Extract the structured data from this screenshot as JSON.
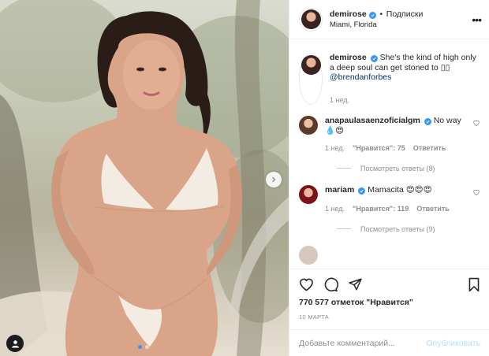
{
  "post": {
    "username": "demirose",
    "separator": "•",
    "follow_label": "Подписки",
    "location": "Miami, Florida",
    "more_label": "•••"
  },
  "caption": {
    "username": "demirose",
    "text": "She's the kind of high only a deep soul can get stoned to",
    "emoji": "▯▯",
    "mention": "@brendanforbes",
    "time": "1 нед."
  },
  "comments": [
    {
      "username": "anapaulasaenzoficialgm",
      "text": "No way 💧😍",
      "time": "1 нед.",
      "likes": "\"Нравится\": 75",
      "reply": "Ответить",
      "view_replies": "Посмотреть ответы (8)"
    },
    {
      "username": "mariam",
      "text": "Mamacita 😍😍😍",
      "time": "1 нед.",
      "likes": "\"Нравится\": 119",
      "reply": "Ответить",
      "view_replies": "Посмотреть ответы (9)"
    }
  ],
  "footer": {
    "likes": "770 577 отметок \"Нравится\"",
    "date": "10 МАРТА",
    "comment_placeholder": "Добавьте комментарий...",
    "publish_label": "Опубликовать"
  },
  "carousel": {
    "total": 2,
    "active": 1
  },
  "colors": {
    "accent": "#3897f0",
    "link": "#003569",
    "muted": "#8e8e8e",
    "publish_disabled": "#b2dffc"
  },
  "icons": [
    "chevron-right-icon",
    "user-tag-icon",
    "verified-icon",
    "heart-icon",
    "comment-icon",
    "share-icon",
    "bookmark-icon",
    "more-icon"
  ]
}
